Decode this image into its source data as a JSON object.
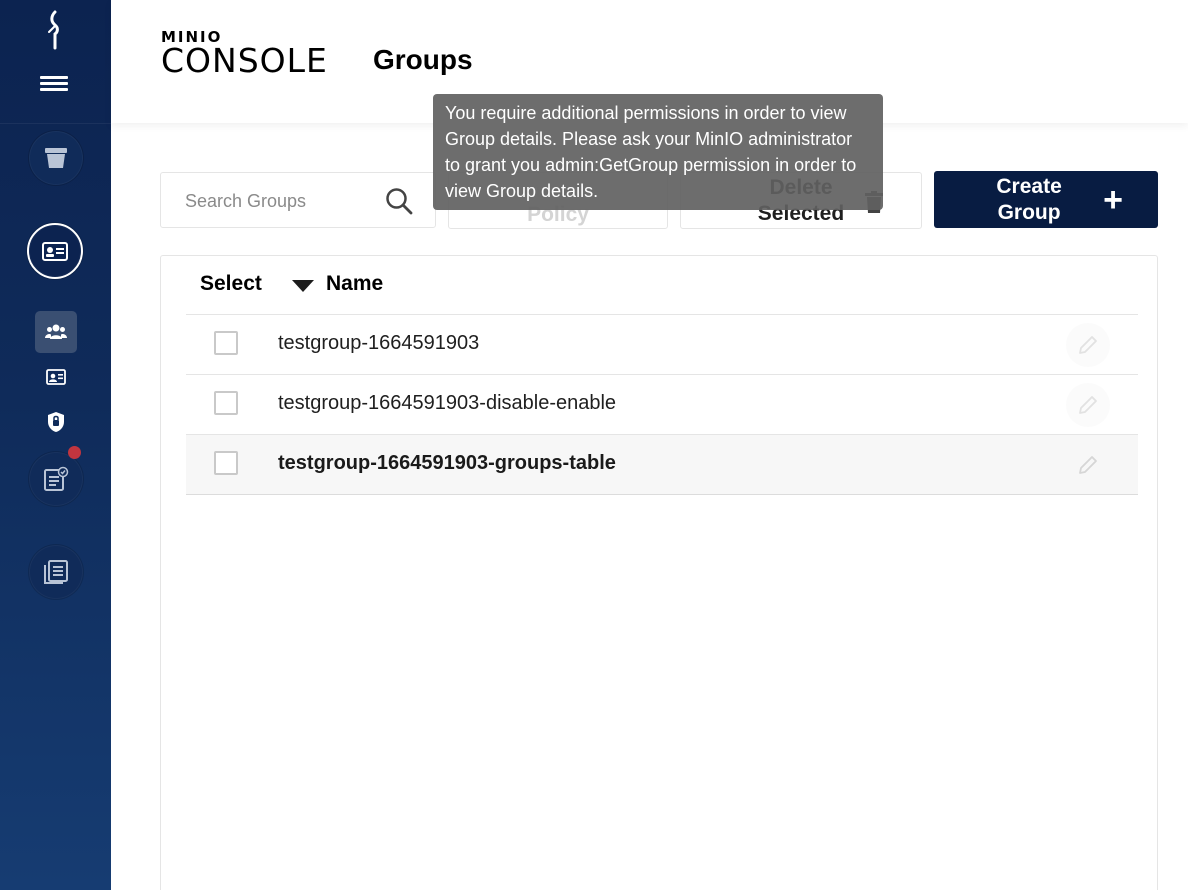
{
  "brand": {
    "top": "MINIO",
    "bottom": "CONSOLE"
  },
  "header": {
    "title": "Groups"
  },
  "sidebar": {
    "icons": [
      "minio-logo-icon",
      "hamburger-menu-icon",
      "bucket-icon",
      "identity-icon",
      "groups-icon",
      "users-icon",
      "policies-icon",
      "monitoring-icon",
      "documentation-icon"
    ],
    "notification": true
  },
  "search": {
    "placeholder": "Search Groups",
    "value": ""
  },
  "toolbar": {
    "policy_label": "Policy",
    "delete_label": "Delete Selected",
    "create_label": "Create Group"
  },
  "tooltip": {
    "text": "You require additional permissions in order to view Group details. Please ask your MinIO administrator to grant you admin:GetGroup permission in order to view Group details."
  },
  "table": {
    "columns": {
      "select": "Select",
      "name": "Name"
    },
    "rows": [
      {
        "name": "testgroup-1664591903",
        "selected": false
      },
      {
        "name": "testgroup-1664591903-disable-enable",
        "selected": false
      },
      {
        "name": "testgroup-1664591903-groups-table",
        "selected": false
      }
    ]
  },
  "colors": {
    "sidebar": "#0f2b5a",
    "primary": "#081c42",
    "notification": "#c1353f",
    "tooltip": "#616161"
  }
}
